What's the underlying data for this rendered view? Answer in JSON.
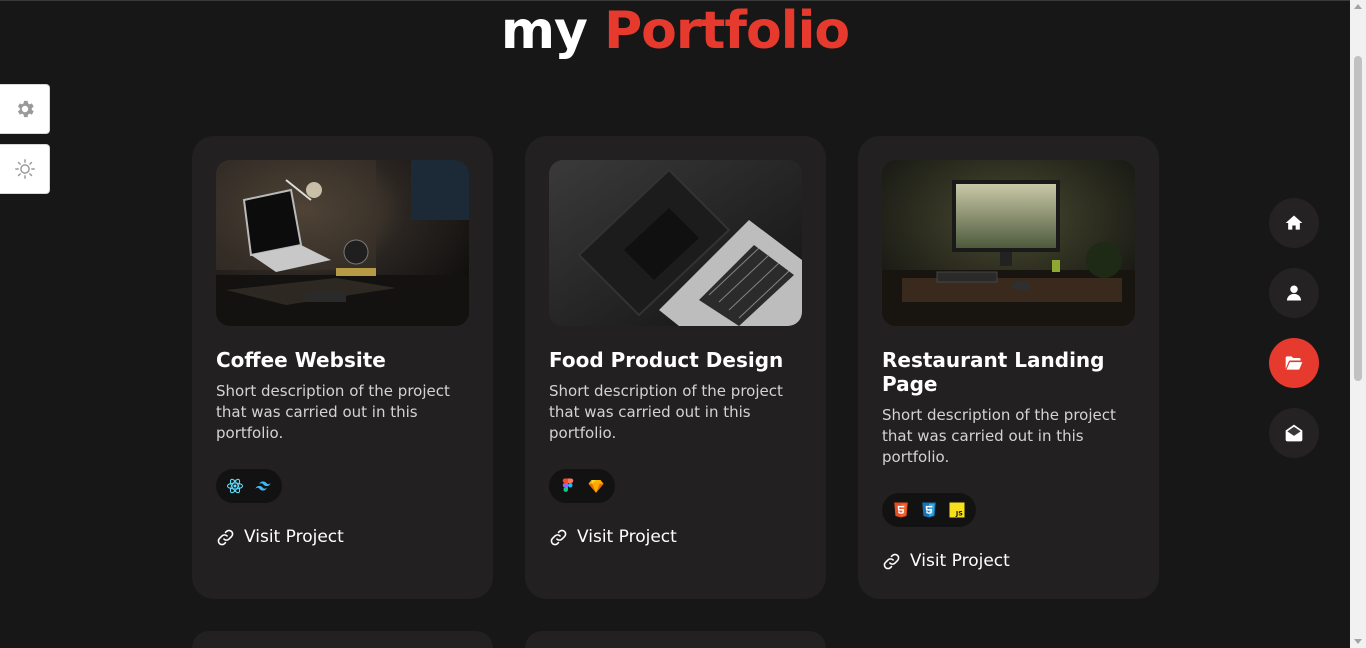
{
  "title": {
    "part1": "my",
    "part2": "Portfolio"
  },
  "colors": {
    "accent": "#e63a2e",
    "background": "#181717",
    "card": "#222020"
  },
  "side_tools": [
    {
      "name": "settings",
      "icon": "gear-icon"
    },
    {
      "name": "theme",
      "icon": "sun-icon"
    }
  ],
  "projects": [
    {
      "title": "Coffee Website",
      "description": "Short description of the project that was carried out in this portfolio.",
      "tech": [
        "react-icon",
        "tailwind-icon"
      ],
      "link_label": "Visit Project"
    },
    {
      "title": "Food Product Design",
      "description": "Short description of the project that was carried out in this portfolio.",
      "tech": [
        "figma-icon",
        "sketch-icon"
      ],
      "link_label": "Visit Project"
    },
    {
      "title": "Restaurant Landing Page",
      "description": "Short description of the project that was carried out in this portfolio.",
      "tech": [
        "html5-icon",
        "css3-icon",
        "javascript-icon"
      ],
      "link_label": "Visit Project"
    }
  ],
  "nav": [
    {
      "name": "home",
      "icon": "home-icon",
      "active": false
    },
    {
      "name": "about",
      "icon": "user-icon",
      "active": false
    },
    {
      "name": "portfolio",
      "icon": "folder-open-icon",
      "active": true
    },
    {
      "name": "contact",
      "icon": "envelope-open-icon",
      "active": false
    }
  ]
}
